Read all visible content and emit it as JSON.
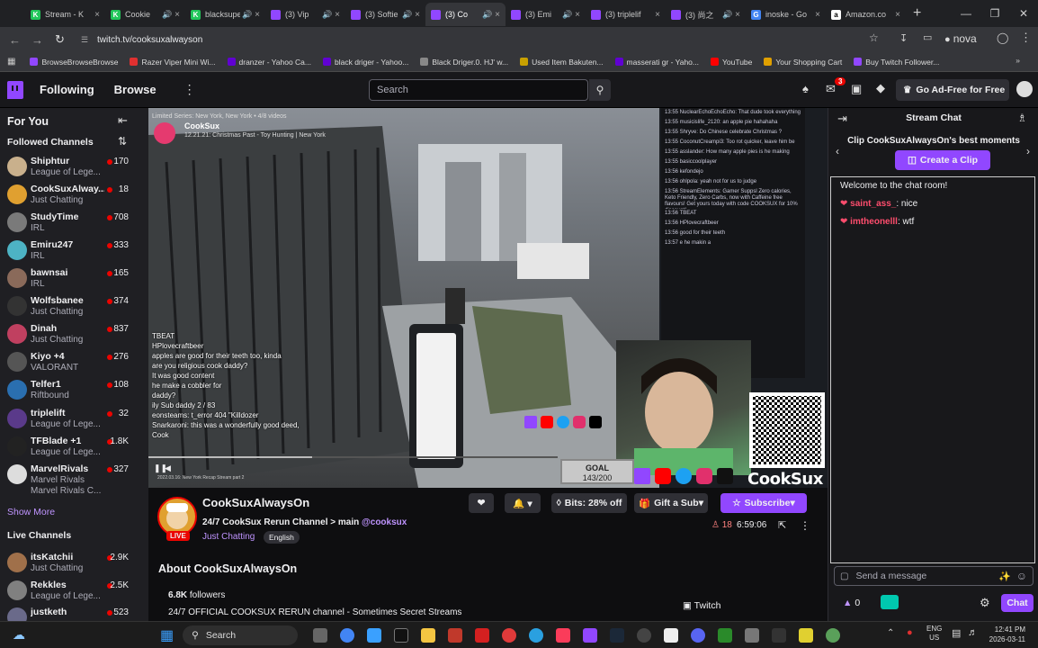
{
  "browser": {
    "tabs": [
      {
        "label": "Stream - K",
        "color": "#21c65a",
        "glyph": "K",
        "muted": false
      },
      {
        "label": "Cookie",
        "color": "#21c65a",
        "glyph": "K",
        "muted": true
      },
      {
        "label": "blacksupe",
        "color": "#21c65a",
        "glyph": "K",
        "muted": true
      },
      {
        "label": "(3) Vip",
        "color": "#9147ff",
        "glyph": "",
        "muted": true
      },
      {
        "label": "(3) Softie",
        "color": "#9147ff",
        "glyph": "",
        "muted": true
      },
      {
        "label": "(3) Co",
        "color": "#9147ff",
        "glyph": "",
        "muted": true,
        "active": true
      },
      {
        "label": "(3) Emi",
        "color": "#9147ff",
        "glyph": "",
        "muted": true
      },
      {
        "label": "(3) triplelif",
        "color": "#9147ff",
        "glyph": "",
        "muted": false
      },
      {
        "label": "(3) 尚之",
        "color": "#9147ff",
        "glyph": "",
        "muted": true
      },
      {
        "label": "inoske - Go",
        "color": "#4285f4",
        "glyph": "G",
        "muted": false
      },
      {
        "label": "Amazon.co",
        "color": "#ffffff",
        "glyph": "a",
        "muted": false
      }
    ],
    "new_tab": "+",
    "url": "twitch.tv/cooksuxalwayson",
    "profile": "nova",
    "bookmarks": [
      {
        "label": "BrowseBrowseBrowse",
        "color": "#9147ff"
      },
      {
        "label": "Razer Viper Mini Wi...",
        "color": "#e03030"
      },
      {
        "label": "dranzer - Yahoo Ca...",
        "color": "#6001d2"
      },
      {
        "label": "black driger - Yahoo...",
        "color": "#6001d2"
      },
      {
        "label": "Black Driger.0. HJ' w...",
        "color": "#888888"
      },
      {
        "label": "Used Item Bakuten...",
        "color": "#c8a000"
      },
      {
        "label": "masserati gr - Yaho...",
        "color": "#6001d2"
      },
      {
        "label": "YouTube",
        "color": "#ff0000"
      },
      {
        "label": "Your Shopping Cart",
        "color": "#e0a000"
      },
      {
        "label": "Buy Twitch Follower...",
        "color": "#9147ff"
      }
    ]
  },
  "nav": {
    "following": "Following",
    "browse": "Browse",
    "search_placeholder": "Search",
    "notif_count": "3",
    "ad_free": "Go Ad-Free for Free"
  },
  "sidebar": {
    "for_you": "For You",
    "followed_title": "Followed Channels",
    "channels": [
      {
        "name": "Shiphtur",
        "game": "League of Lege...",
        "viewers": "170",
        "color": "#c9b08c"
      },
      {
        "name": "CookSuxAlway...",
        "game": "Just Chatting",
        "viewers": "18",
        "color": "#e0a030"
      },
      {
        "name": "StudyTime",
        "game": "IRL",
        "viewers": "708",
        "color": "#7a7a7a"
      },
      {
        "name": "Emiru247",
        "game": "IRL",
        "viewers": "333",
        "color": "#4db3c4"
      },
      {
        "name": "bawnsai",
        "game": "IRL",
        "viewers": "165",
        "color": "#8a6a5a"
      },
      {
        "name": "Wolfsbanee",
        "game": "Just Chatting",
        "viewers": "374",
        "color": "#333333"
      },
      {
        "name": "Dinah",
        "game": "Just Chatting",
        "viewers": "837",
        "color": "#c04060"
      },
      {
        "name": "Kiyo +4",
        "game": "VALORANT",
        "viewers": "276",
        "color": "#555555"
      },
      {
        "name": "Telfer1",
        "game": "Riftbound",
        "viewers": "108",
        "color": "#2a6fb0"
      },
      {
        "name": "triplelift",
        "game": "League of Lege...",
        "viewers": "32",
        "color": "#5a3a8a"
      },
      {
        "name": "TFBlade +1",
        "game": "League of Lege...",
        "viewers": "1.8K",
        "color": "#222222"
      },
      {
        "name": "MarvelRivals",
        "game": "Marvel Rivals",
        "game2": "Marvel Rivals C...",
        "viewers": "327",
        "color": "#dddddd"
      }
    ],
    "show_more": "Show More",
    "live_title": "Live Channels",
    "live": [
      {
        "name": "itsKatchii",
        "game": "Just Chatting",
        "viewers": "2.9K",
        "color": "#a0704a"
      },
      {
        "name": "Rekkles",
        "game": "League of Lege...",
        "viewers": "2.5K",
        "color": "#808080"
      },
      {
        "name": "justketh",
        "game": "",
        "viewers": "523",
        "color": "#6a6a8a"
      }
    ]
  },
  "player": {
    "series_line": "Limited Series: New York, New York • 4/8 videos",
    "channel_tag": "CookSux",
    "episode": "12.21.21: Christmas Past - Toy Hunting | New York",
    "overlay_chat": [
      "TBEAT",
      "HPlovecraftbeer",
      "apples are good for their teeth too, kinda",
      "are you religious cook daddy?",
      "It was good content",
      "he make a cobbler for",
      "daddy?",
      "ily Sub daddy 2 / 83",
      "eonsteams: t_error 404 \"Killdozer",
      "Snarkaroni: this was a wonderfully good deed,",
      "Cook"
    ],
    "side_chat": [
      "13:55  NuclearEchoEchoEcho: That dude took everything",
      "13:55  musicislife_2120: an apple pie hahahaha",
      "13:55  Shryve: Do Chinese celebrate Christmas ?",
      "13:55  CoconutCreampi3: Too rot quicker, leave him be",
      "13:55  asslander: How many apple pies is he making",
      "13:55  basiccoolplayer",
      "13:56  kefondejo",
      "13:56  ohlpola: yeah not for us to judge",
      "13:56  StreamElements: Gamer Suppsl Zero calories, Keto Friendly, Zero Carbs, now with Caffeine free flavours! Get yours today with code COOKSUX for 10% discount!",
      "13:56  TBEAT",
      "13:56  HPlovecraftbeer",
      "13:56  good for their teeth",
      "13:57  e he makin a"
    ],
    "goal_label": "GOAL",
    "goal_value": "143/200",
    "vod_title": "2022.03.16: New York Recap Stream part 2",
    "brand": "CookSux"
  },
  "info": {
    "channel_name": "CookSuxAlwaysOn",
    "stream_title": "24/7 CookSux Rerun Channel > main",
    "mention": "@cooksux",
    "category": "Just Chatting",
    "language": "English",
    "live_badge": "LIVE",
    "bits": "Bits: 28% off",
    "gift": "Gift a Sub",
    "subscribe": "Subscribe",
    "viewers": "18",
    "uptime": "6:59:06",
    "about_title": "About CookSuxAlwaysOn",
    "followers_count": "6.8K",
    "followers_label": "followers",
    "description": "24/7 OFFICIAL COOKSUX RERUN channel - Sometimes Secret Streams",
    "twitch_link": "Twitch"
  },
  "chat": {
    "title": "Stream Chat",
    "clip_prompt": "Clip CookSuxAlwaysOn's best moments",
    "create_clip": "Create a Clip",
    "welcome": "Welcome to the chat room!",
    "messages": [
      {
        "user": "saint_ass_",
        "text": ": nice",
        "color": "#ff4d6d"
      },
      {
        "user": "imtheonelll",
        "text": ": wtf",
        "color": "#ff4d6d"
      }
    ],
    "placeholder": "Send a message",
    "points": "0",
    "chat_button": "Chat"
  },
  "taskbar": {
    "search": "Search",
    "lang1": "ENG",
    "lang2": "US",
    "time": "12:41 PM",
    "date": "2026-03-11"
  }
}
